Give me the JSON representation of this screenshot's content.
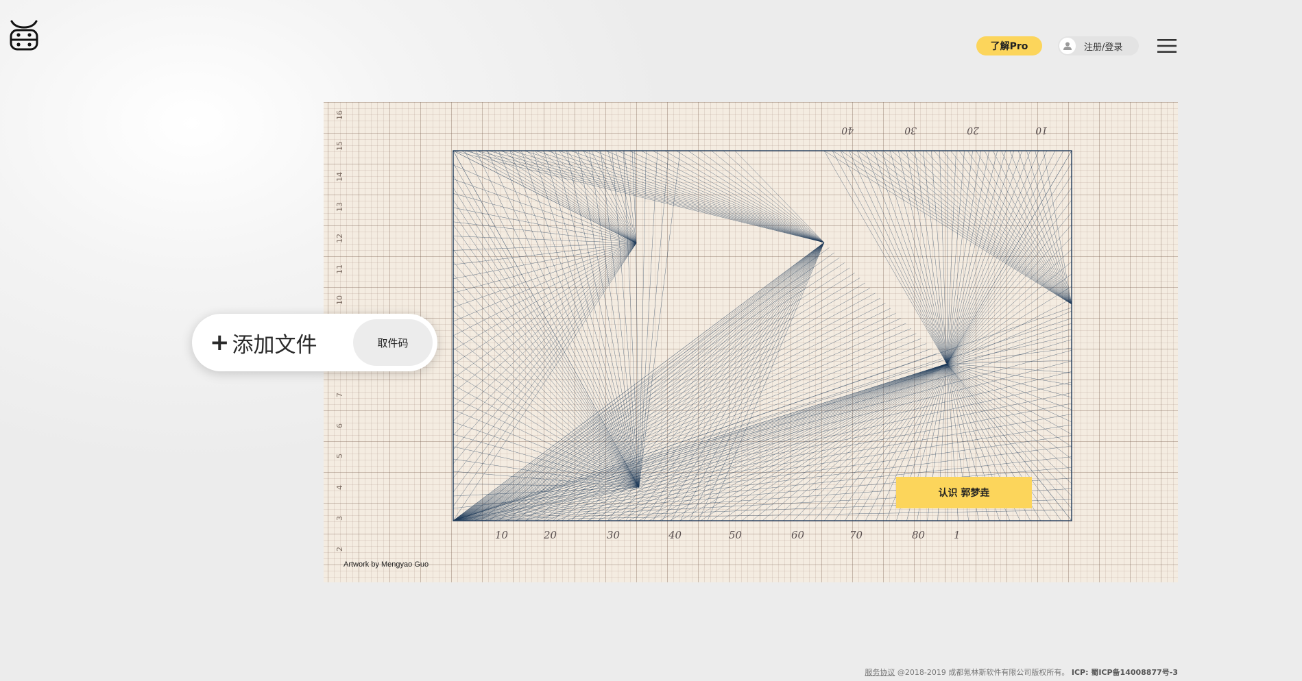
{
  "header": {
    "logo_icon": "cow-face-icon",
    "pro_label": "了解Pro",
    "login_label": "注册/登录",
    "avatar_icon": "user-icon",
    "menu_icon": "hamburger-menu-icon"
  },
  "upload": {
    "plus_icon": "+",
    "add_file_label": "添加文件",
    "code_label": "取件码"
  },
  "artwork": {
    "credit": "Artwork by Mengyao Guo",
    "artist_button_label": "认识 郭梦垚",
    "bottom_numbers": [
      "10",
      "20",
      "30",
      "40",
      "50",
      "60",
      "70",
      "80",
      "1"
    ],
    "top_numbers": [
      "40",
      "30",
      "20",
      "10"
    ],
    "left_numbers": [
      "16",
      "15",
      "14",
      "13",
      "12",
      "11",
      "10",
      "7",
      "6",
      "5",
      "4",
      "3",
      "2"
    ],
    "line_color": "#1e3a5a"
  },
  "footer": {
    "terms_link": "服务协议",
    "copyright": "@2018-2019 成都氪林斯软件有限公司版权所有。",
    "icp_label": "ICP: 蜀ICP备14008877号-3"
  },
  "colors": {
    "accent": "#fcd55b",
    "background": "#efefef",
    "paper": "#f4ece1"
  }
}
